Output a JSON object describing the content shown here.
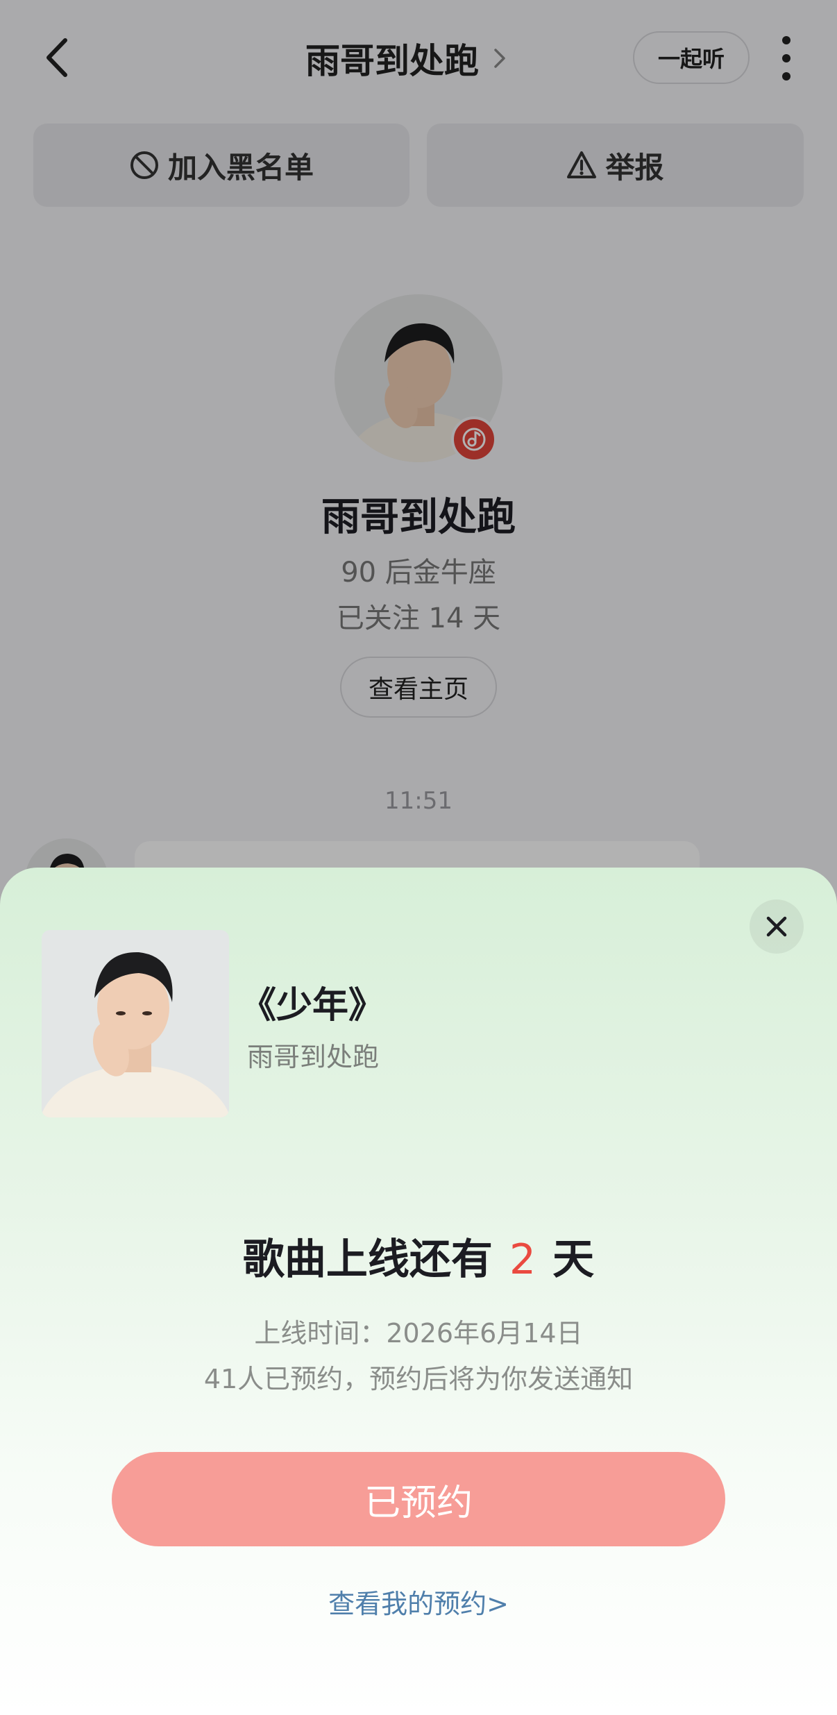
{
  "header": {
    "title": "雨哥到处跑",
    "listen_together_label": "一起听"
  },
  "actions": {
    "blacklist_label": "加入黑名单",
    "report_label": "举报"
  },
  "profile": {
    "name": "雨哥到处跑",
    "tags": "90 后金牛座",
    "follow_status": "已关注 14 天",
    "homepage_label": "查看主页"
  },
  "chat": {
    "time": "11:51"
  },
  "sheet": {
    "song_title": "《少年》",
    "artist": "雨哥到处跑",
    "countdown_prefix": "歌曲上线还有",
    "countdown_days": "2",
    "countdown_suffix": "天",
    "release_date": "上线时间：2026年6月14日",
    "reserve_info": "41人已预约，预约后将为你发送通知",
    "reserved_button_label": "已预约",
    "my_reservations_link": "查看我的预约>"
  },
  "colors": {
    "accent_red": "#ea4a40",
    "reserved_button": "#f79d97",
    "link_blue": "#4f7fab",
    "sheet_green": "#d7efd8"
  },
  "icons": {
    "back": "chevron-left-icon",
    "title_chevron": "chevron-right-icon",
    "more": "more-vertical-icon",
    "blacklist": "block-icon",
    "report": "warning-icon",
    "music_badge": "music-note-icon",
    "close": "close-icon"
  }
}
